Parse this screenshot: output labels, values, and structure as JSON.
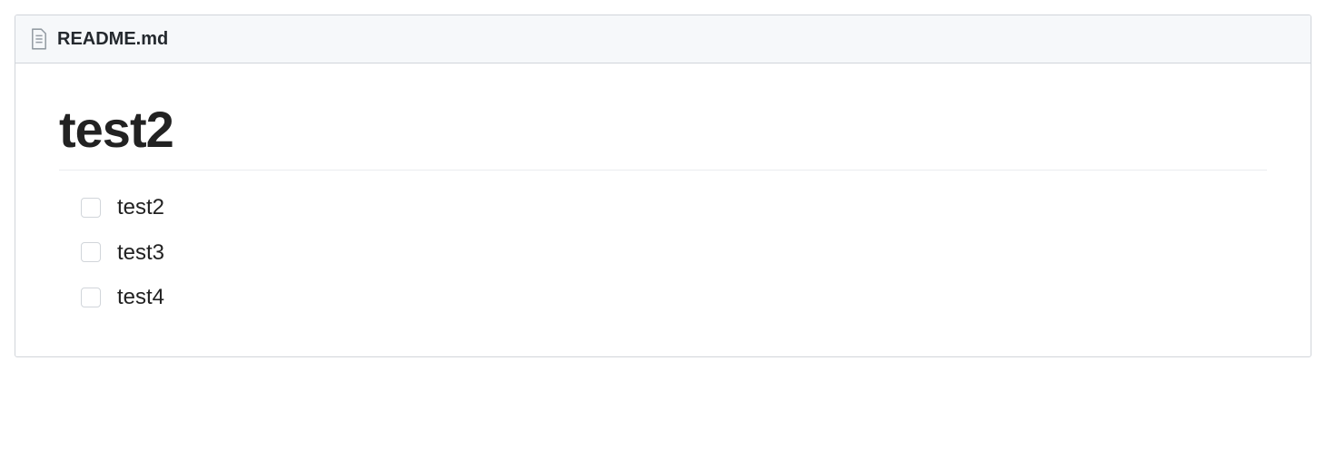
{
  "header": {
    "filename": "README.md"
  },
  "content": {
    "title": "test2",
    "tasks": [
      {
        "label": "test2",
        "checked": false
      },
      {
        "label": "test3",
        "checked": false
      },
      {
        "label": "test4",
        "checked": false
      }
    ]
  }
}
